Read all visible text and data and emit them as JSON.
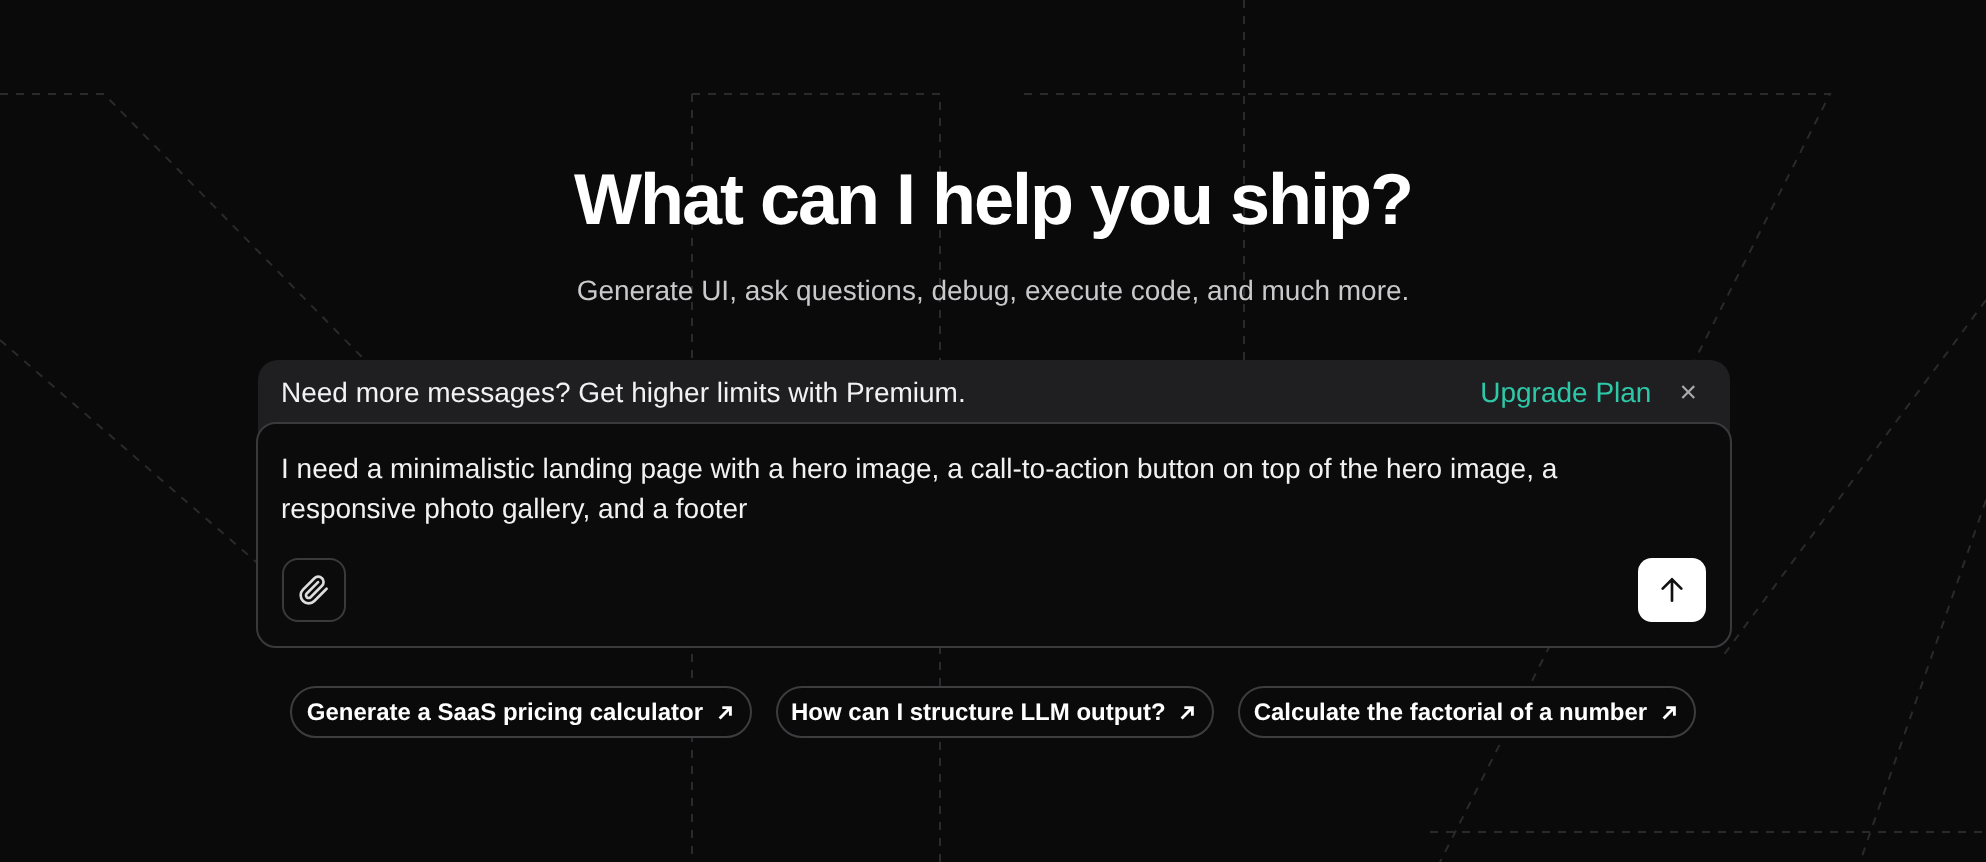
{
  "heading": "What can I help you ship?",
  "subtitle": "Generate UI, ask questions, debug, execute code, and much more.",
  "banner": {
    "message": "Need more messages? Get higher limits with Premium.",
    "link": "Upgrade Plan",
    "close": "×"
  },
  "prompt": {
    "value": "I need a minimalistic landing page with a hero image, a call-to-action button on top of the hero image, a responsive photo gallery, and a footer"
  },
  "suggestions": [
    "Generate a SaaS pricing calculator",
    "How can I structure LLM output?",
    "Calculate the factorial of a number"
  ]
}
